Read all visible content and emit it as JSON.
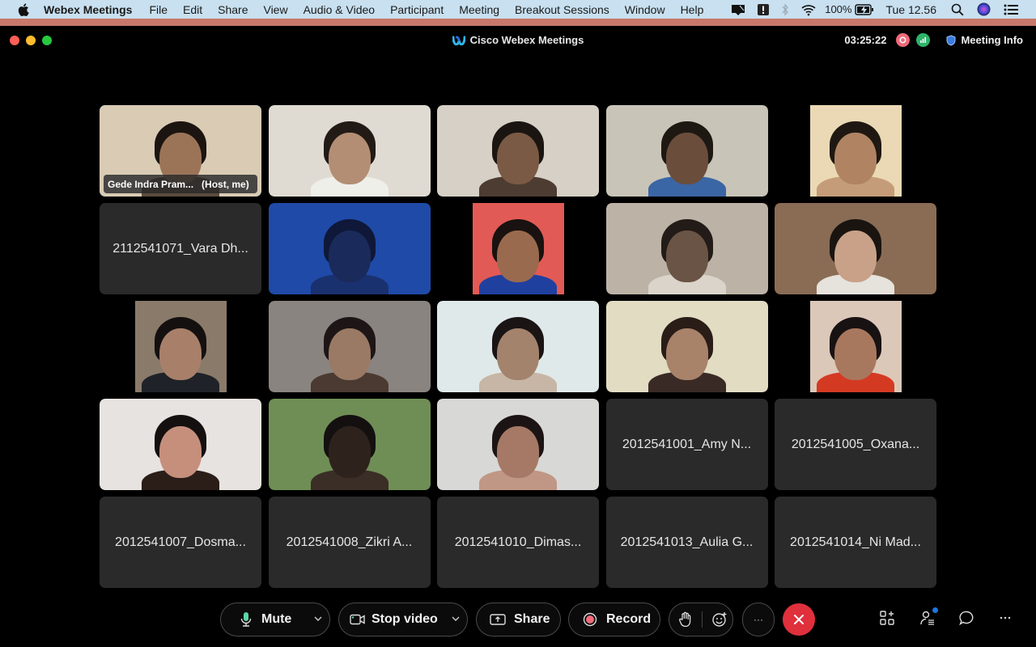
{
  "menubar": {
    "apple_icon": "apple-logo-icon",
    "app_name": "Webex Meetings",
    "items": [
      "File",
      "Edit",
      "Share",
      "View",
      "Audio & Video",
      "Participant",
      "Meeting",
      "Breakout Sessions",
      "Window",
      "Help"
    ],
    "status": {
      "battery": "100%",
      "clock": "Tue 12.56",
      "icons": [
        "screen-share-icon",
        "alert-icon",
        "bluetooth-icon",
        "wifi-icon",
        "battery-charging-icon",
        "spotlight-search-icon",
        "siri-icon",
        "control-center-icon"
      ]
    }
  },
  "window": {
    "title": "Cisco Webex Meetings",
    "timer": "03:25:22",
    "meeting_info": "Meeting Info",
    "colors": {
      "accent": "#2fb6ea",
      "record": "#f06a7a",
      "network": "#2fb36a",
      "end_call": "#e0303c"
    }
  },
  "participants": [
    {
      "type": "video",
      "name": "Gede Indra Pram...",
      "role": "(Host, me)",
      "active": true,
      "bg": "#d9cbb4",
      "skin": "#9b7458",
      "hair": "#1c1410",
      "shirt": "#5b4c3e"
    },
    {
      "type": "video",
      "bg": "#e0dbd2",
      "skin": "#b38e74",
      "hair": "#221a15",
      "shirt": "#efefe9"
    },
    {
      "type": "video",
      "bg": "#d6d0c6",
      "skin": "#7a5a45",
      "hair": "#1b1511",
      "shirt": "#4d3c31"
    },
    {
      "type": "video",
      "bg": "#c9c4b8",
      "skin": "#6b4d3c",
      "hair": "#1e1813",
      "shirt": "#3a66a5"
    },
    {
      "type": "portrait",
      "bg": "#ead9b4",
      "skin": "#b08463",
      "hair": "#1f1812",
      "shirt": "#c59c79"
    },
    {
      "type": "name",
      "name": "2112541071_Vara Dh..."
    },
    {
      "type": "video",
      "bg": "#1f4aa8",
      "skin": "#1a2a5a",
      "hair": "#0f1838",
      "shirt": "#1a3170"
    },
    {
      "type": "portrait",
      "bg": "#e25a55",
      "skin": "#9a6a4e",
      "hair": "#191210",
      "shirt": "#2040a0"
    },
    {
      "type": "video",
      "bg": "#bcb3a6",
      "skin": "#6a5446",
      "hair": "#231b17",
      "shirt": "#dad4ca"
    },
    {
      "type": "video",
      "bg": "#8a6c55",
      "skin": "#c9a189",
      "hair": "#1a1410",
      "shirt": "#e6e2dc"
    },
    {
      "type": "portrait",
      "bg": "#8a7a6a",
      "skin": "#a8806a",
      "hair": "#151010",
      "shirt": "#1f2228"
    },
    {
      "type": "video",
      "bg": "#8a8480",
      "skin": "#9a7a65",
      "hair": "#1e1616",
      "shirt": "#4a3a32"
    },
    {
      "type": "video",
      "bg": "#dfe9ea",
      "skin": "#a3836c",
      "hair": "#1a1414",
      "shirt": "#c7b6a6"
    },
    {
      "type": "video",
      "bg": "#e1dcc2",
      "skin": "#a9826a",
      "hair": "#2a1c16",
      "shirt": "#3a2a25"
    },
    {
      "type": "portrait",
      "bg": "#dcc8b8",
      "skin": "#a8785e",
      "hair": "#181212",
      "shirt": "#d43a22"
    },
    {
      "type": "video",
      "bg": "#e6e3e0",
      "skin": "#c68f7c",
      "hair": "#151010",
      "shirt": "#2b1d18"
    },
    {
      "type": "video",
      "bg": "#6f8e55",
      "skin": "#2e221c",
      "hair": "#141010",
      "shirt": "#3a2e26"
    },
    {
      "type": "video",
      "bg": "#d8d8d6",
      "skin": "#a57966",
      "hair": "#1c1414",
      "shirt": "#c09784"
    },
    {
      "type": "name",
      "name": "2012541001_Amy N..."
    },
    {
      "type": "name",
      "name": "2012541005_Oxana..."
    },
    {
      "type": "name",
      "name": "2012541007_Dosma..."
    },
    {
      "type": "name",
      "name": "2012541008_Zikri A..."
    },
    {
      "type": "name",
      "name": "2012541010_Dimas..."
    },
    {
      "type": "name",
      "name": "2012541013_Aulia G..."
    },
    {
      "type": "name",
      "name": "2012541014_Ni Mad..."
    }
  ],
  "controls": {
    "mute": "Mute",
    "stop_video": "Stop video",
    "share": "Share",
    "record": "Record",
    "raise_hand_icon": "raise-hand-icon",
    "reactions_icon": "reactions-icon",
    "more_label": "···",
    "end_icon": "close-icon",
    "right": [
      "apps-icon",
      "participants-icon",
      "chat-icon",
      "more-icon"
    ]
  }
}
